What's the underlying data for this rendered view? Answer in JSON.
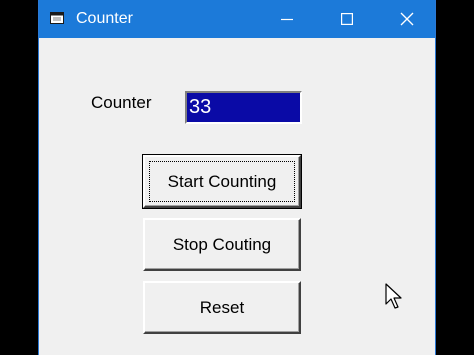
{
  "window": {
    "title": "Counter",
    "title_bar_color": "#1c7ad9",
    "icons": {
      "app": "window-icon",
      "minimize": "minimize-icon",
      "maximize": "maximize-icon",
      "close": "close-icon"
    }
  },
  "form": {
    "counter_label": "Counter",
    "counter_value": "33",
    "counter_value_bg": "#0a0aa6",
    "buttons": {
      "start": "Start Counting",
      "stop": "Stop Couting",
      "reset": "Reset"
    }
  },
  "pointer": {
    "icon": "mouse-pointer-icon"
  }
}
